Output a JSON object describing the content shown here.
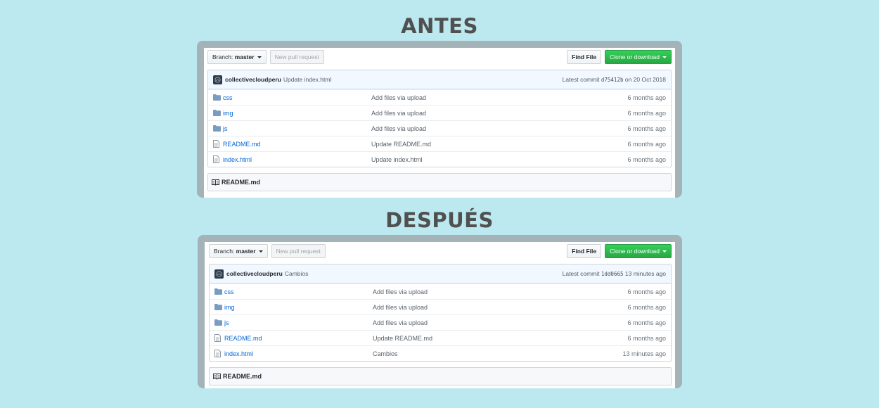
{
  "titles": {
    "before": "ANTES",
    "after": "DESPUÉS"
  },
  "colors": {
    "background": "#bce9f0",
    "frame": "#a3b3b7",
    "clone_green": "#28a745",
    "link_blue": "#0366d6"
  },
  "before": {
    "toolbar": {
      "branch_prefix": "Branch:",
      "branch_name": "master",
      "new_pr": "New pull request",
      "find_file": "Find File",
      "clone": "Clone or download"
    },
    "commit": {
      "author": "collectivecloudperu",
      "message": "Update index.html",
      "latest_label": "Latest commit",
      "sha": "d75412b",
      "when": "on 20 Oct 2018"
    },
    "files": [
      {
        "icon": "folder-icon",
        "name": "css",
        "message": "Add files via upload",
        "age": "6 months ago"
      },
      {
        "icon": "folder-icon",
        "name": "img",
        "message": "Add files via upload",
        "age": "6 months ago"
      },
      {
        "icon": "folder-icon",
        "name": "js",
        "message": "Add files via upload",
        "age": "6 months ago"
      },
      {
        "icon": "file-icon",
        "name": "README.md",
        "message": "Update README.md",
        "age": "6 months ago"
      },
      {
        "icon": "file-icon",
        "name": "index.html",
        "message": "Update index.html",
        "age": "6 months ago"
      }
    ],
    "readme": "README.md"
  },
  "after": {
    "toolbar": {
      "branch_prefix": "Branch:",
      "branch_name": "master",
      "new_pr": "New pull request",
      "find_file": "Find File",
      "clone": "Clone or download"
    },
    "commit": {
      "author": "collectivecloudperu",
      "message": "Cambios",
      "latest_label": "Latest commit",
      "sha": "1dd0665",
      "when": "13 minutes ago"
    },
    "files": [
      {
        "icon": "folder-icon",
        "name": "css",
        "message": "Add files via upload",
        "age": "6 months ago"
      },
      {
        "icon": "folder-icon",
        "name": "img",
        "message": "Add files via upload",
        "age": "6 months ago"
      },
      {
        "icon": "folder-icon",
        "name": "js",
        "message": "Add files via upload",
        "age": "6 months ago"
      },
      {
        "icon": "file-icon",
        "name": "README.md",
        "message": "Update README.md",
        "age": "6 months ago"
      },
      {
        "icon": "file-icon",
        "name": "index.html",
        "message": "Cambios",
        "age": "13 minutes ago"
      }
    ],
    "readme": "README.md"
  }
}
